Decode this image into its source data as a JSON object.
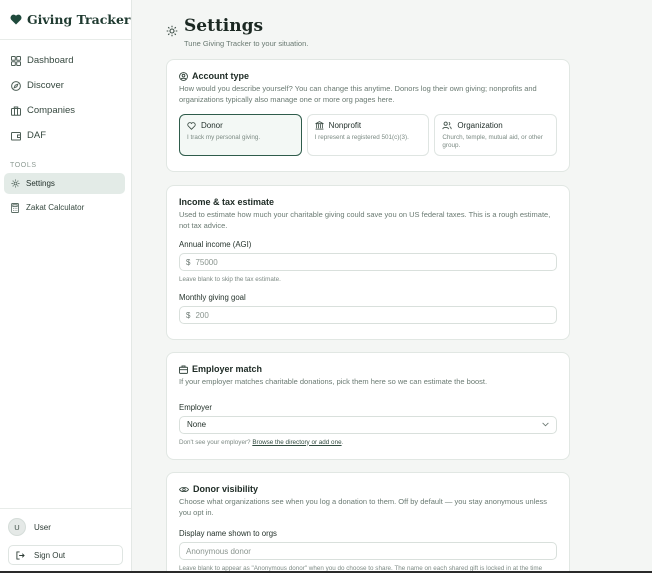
{
  "brand": {
    "name": "Giving Tracker",
    "accent": "#1f4a3c"
  },
  "nav": [
    {
      "label": "Dashboard",
      "icon": "dashboard-icon"
    },
    {
      "label": "Discover",
      "icon": "compass-icon"
    },
    {
      "label": "Companies",
      "icon": "briefcase-icon"
    },
    {
      "label": "DAF",
      "icon": "wallet-icon"
    }
  ],
  "tools": {
    "section_label": "TOOLS",
    "items": [
      {
        "label": "Settings",
        "icon": "gear-icon",
        "active": true
      },
      {
        "label": "Zakat Calculator",
        "icon": "calculator-icon",
        "active": false
      }
    ]
  },
  "user": {
    "initial": "U",
    "name": "User",
    "signout_label": "Sign Out"
  },
  "page": {
    "title": "Settings",
    "subtitle": "Tune Giving Tracker to your situation."
  },
  "account": {
    "title": "Account type",
    "description": "How would you describe yourself? You can change this anytime. Donors log their own giving; nonprofits and organizations typically also manage one or more org pages here.",
    "options": [
      {
        "name": "Donor",
        "desc": "I track my personal giving.",
        "icon": "heart-icon",
        "selected": true
      },
      {
        "name": "Nonprofit",
        "desc": "I represent a registered 501(c)(3).",
        "icon": "building-icon",
        "selected": false
      },
      {
        "name": "Organization",
        "desc": "Church, temple, mutual aid, or other group.",
        "icon": "people-icon",
        "selected": false
      }
    ]
  },
  "income": {
    "title": "Income & tax estimate",
    "description": "Used to estimate how much your charitable giving could save you on US federal taxes. This is a rough estimate, not tax advice.",
    "agi_label": "Annual income (AGI)",
    "agi_prefix": "$",
    "agi_placeholder": "75000",
    "agi_help": "Leave blank to skip the tax estimate.",
    "goal_label": "Monthly giving goal",
    "goal_prefix": "$",
    "goal_placeholder": "200"
  },
  "employer": {
    "title": "Employer match",
    "description": "If your employer matches charitable donations, pick them here so we can estimate the boost.",
    "field_label": "Employer",
    "selected": "None",
    "help_prefix": "Don't see your employer?",
    "help_link": "Browse the directory or add one",
    "help_suffix": "."
  },
  "visibility": {
    "title": "Donor visibility",
    "description": "Choose what organizations see when you log a donation to them. Off by default — you stay anonymous unless you opt in.",
    "field_label": "Display name shown to orgs",
    "placeholder": "Anonymous donor",
    "help": "Leave blank to appear as \"Anonymous donor\" when you do choose to share. The name on each shared gift is locked in at the time"
  }
}
